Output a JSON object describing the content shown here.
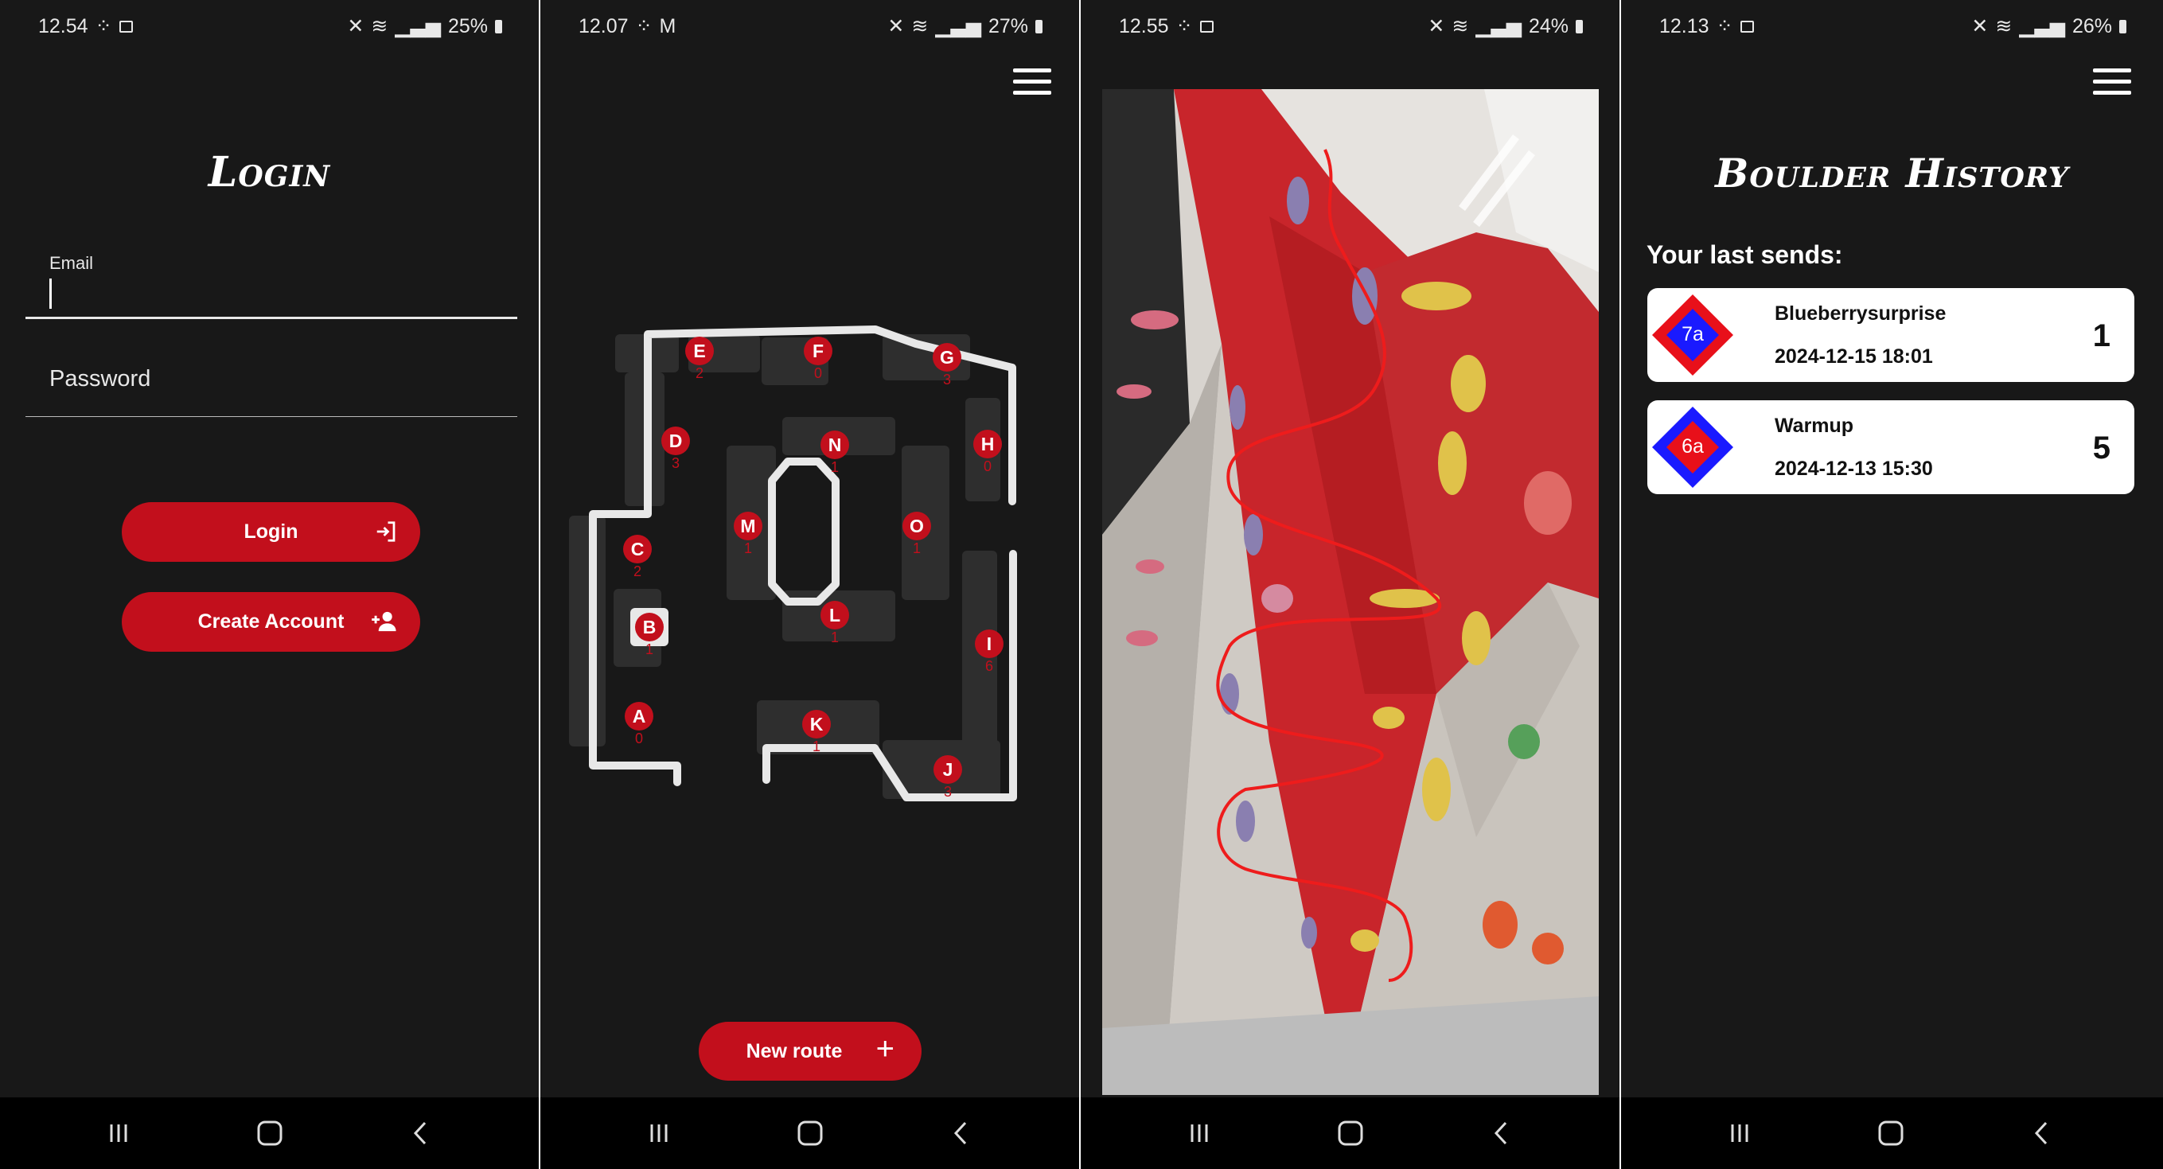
{
  "screens": [
    {
      "status": {
        "time": "12.54",
        "battery": "25%"
      },
      "login": {
        "title": "Login",
        "email_label": "Email",
        "email_value": "",
        "password_placeholder": "Password",
        "login_button": "Login",
        "create_account_button": "Create Account"
      }
    },
    {
      "status": {
        "time": "12.07",
        "battery": "27%"
      },
      "map": {
        "zones": [
          {
            "id": "A",
            "count": "0"
          },
          {
            "id": "B",
            "count": "1"
          },
          {
            "id": "C",
            "count": "2"
          },
          {
            "id": "D",
            "count": "3"
          },
          {
            "id": "E",
            "count": "2"
          },
          {
            "id": "F",
            "count": "0"
          },
          {
            "id": "G",
            "count": "3"
          },
          {
            "id": "H",
            "count": "0"
          },
          {
            "id": "I",
            "count": "6"
          },
          {
            "id": "J",
            "count": "3"
          },
          {
            "id": "K",
            "count": "1"
          },
          {
            "id": "L",
            "count": "1"
          },
          {
            "id": "M",
            "count": "1"
          },
          {
            "id": "N",
            "count": "1"
          },
          {
            "id": "O",
            "count": "1"
          }
        ],
        "new_route_button": "New route"
      }
    },
    {
      "status": {
        "time": "12.55",
        "battery": "24%"
      },
      "photo": {
        "description_icon": "climbing-wall-photo"
      }
    },
    {
      "status": {
        "time": "12.13",
        "battery": "26%"
      },
      "history": {
        "title": "Boulder History",
        "subtitle": "Your last sends:",
        "sends": [
          {
            "grade": "7a",
            "name": "Blueberrysurprise",
            "date": "2024-12-15 18:01",
            "count": "1"
          },
          {
            "grade": "6a",
            "name": "Warmup",
            "date": "2024-12-13 15:30",
            "count": "5"
          }
        ]
      }
    }
  ],
  "colors": {
    "accent": "#c20f1c",
    "background": "#181818",
    "grade_blue": "#1a1aff",
    "grade_red": "#e8101a"
  }
}
